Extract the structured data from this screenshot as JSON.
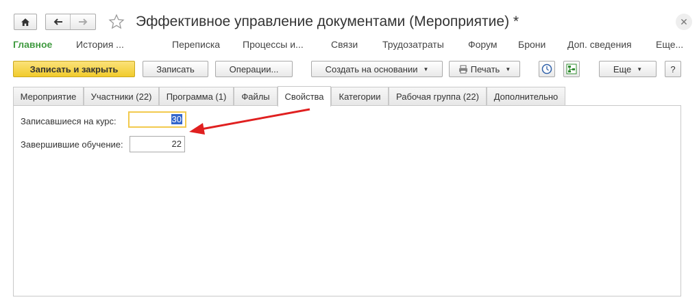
{
  "window": {
    "title": "Эффективное управление документами (Мероприятие) *",
    "close_icon": "close-icon"
  },
  "nav": {
    "home_icon": "home-icon",
    "back_icon": "arrow-left-icon",
    "forward_icon": "arrow-right-icon",
    "star_icon": "star-icon"
  },
  "navbar": {
    "items": [
      {
        "label": "Главное"
      },
      {
        "label": "История ..."
      },
      {
        "label": "Переписка"
      },
      {
        "label": "Процессы и..."
      },
      {
        "label": "Связи"
      },
      {
        "label": "Трудозатраты"
      },
      {
        "label": "Форум"
      },
      {
        "label": "Брони"
      },
      {
        "label": "Доп. сведения"
      },
      {
        "label": "Еще..."
      }
    ]
  },
  "toolbar": {
    "save_close": "Записать и закрыть",
    "save": "Записать",
    "operations": "Операции...",
    "create_based": "Создать на основании",
    "print": "Печать",
    "more": "Еще",
    "help": "?",
    "clock_icon": "clock-icon",
    "structure_icon": "structure-icon",
    "printer_icon": "printer-icon",
    "accent_color": "#f5d547"
  },
  "tabs": [
    {
      "label": "Мероприятие"
    },
    {
      "label": "Участники (22)"
    },
    {
      "label": "Программа (1)"
    },
    {
      "label": "Файлы"
    },
    {
      "label": "Свойства"
    },
    {
      "label": "Категории"
    },
    {
      "label": "Рабочая группа (22)"
    },
    {
      "label": "Дополнительно"
    }
  ],
  "active_tab": "Свойства",
  "form": {
    "enrolled_label": "Записавшиеся на курс:",
    "enrolled_value": "30",
    "completed_label": "Завершившие обучение:",
    "completed_value": "22"
  },
  "annotation": {
    "arrow_color": "#e02020"
  }
}
